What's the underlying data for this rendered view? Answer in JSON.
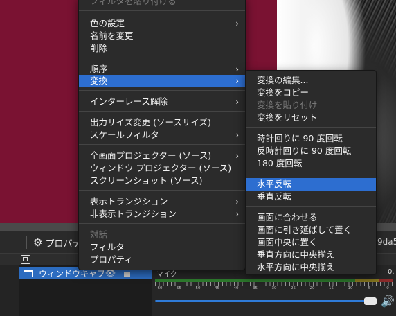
{
  "context_menu": {
    "items": [
      {
        "label": "フィルタを貼り付ける",
        "disabled": true
      },
      {
        "label": "色の設定",
        "submenu": true
      },
      {
        "label": "名前を変更"
      },
      {
        "label": "削除"
      },
      {
        "label": "順序",
        "submenu": true
      },
      {
        "label": "変換",
        "submenu": true,
        "highlighted": true
      },
      {
        "label": "インターレース解除",
        "submenu": true
      },
      {
        "label": "出力サイズ変更 (ソースサイズ)"
      },
      {
        "label": "スケールフィルタ",
        "submenu": true
      },
      {
        "label": "全画面プロジェクター (ソース)",
        "submenu": true
      },
      {
        "label": "ウィンドウ プロジェクター (ソース)"
      },
      {
        "label": "スクリーンショット (ソース)"
      },
      {
        "label": "表示トランジション",
        "submenu": true
      },
      {
        "label": "非表示トランジション",
        "submenu": true
      },
      {
        "label": "対話",
        "disabled": true
      },
      {
        "label": "フィルタ"
      },
      {
        "label": "プロパティ"
      }
    ],
    "submenu_arrow": "›"
  },
  "transform_submenu": {
    "items": [
      {
        "label": "変換の編集..."
      },
      {
        "label": "変換をコピー"
      },
      {
        "label": "変換を貼り付け",
        "disabled": true
      },
      {
        "label": "変換をリセット"
      },
      {
        "label": "時計回りに 90 度回転"
      },
      {
        "label": "反時計回りに 90 度回転"
      },
      {
        "label": "180 度回転"
      },
      {
        "label": "水平反転",
        "highlighted": true
      },
      {
        "label": "垂直反転"
      },
      {
        "label": "画面に合わせる"
      },
      {
        "label": "画面に引き延ばして置く"
      },
      {
        "label": "画面中央に置く"
      },
      {
        "label": "垂直方向に中央揃え"
      },
      {
        "label": "水平方向に中央揃え"
      }
    ]
  },
  "toolbar": {
    "properties_label": "プロパテ",
    "right_text": "9da5"
  },
  "sources": {
    "selected_label": "ウィンドウキャプ"
  },
  "mixer": {
    "label": "マイク",
    "value": "0.",
    "scale": [
      "-60",
      "-55",
      "-50",
      "-45",
      "-40",
      "-35",
      "-30",
      "-25",
      "-20",
      "-15",
      "-10",
      "-5",
      "0"
    ]
  },
  "icons": {
    "gear": "⚙",
    "eye": "👁",
    "volume": "🔊"
  },
  "colors": {
    "highlight": "#2d6ed0",
    "preview_bg": "#7a1232"
  }
}
